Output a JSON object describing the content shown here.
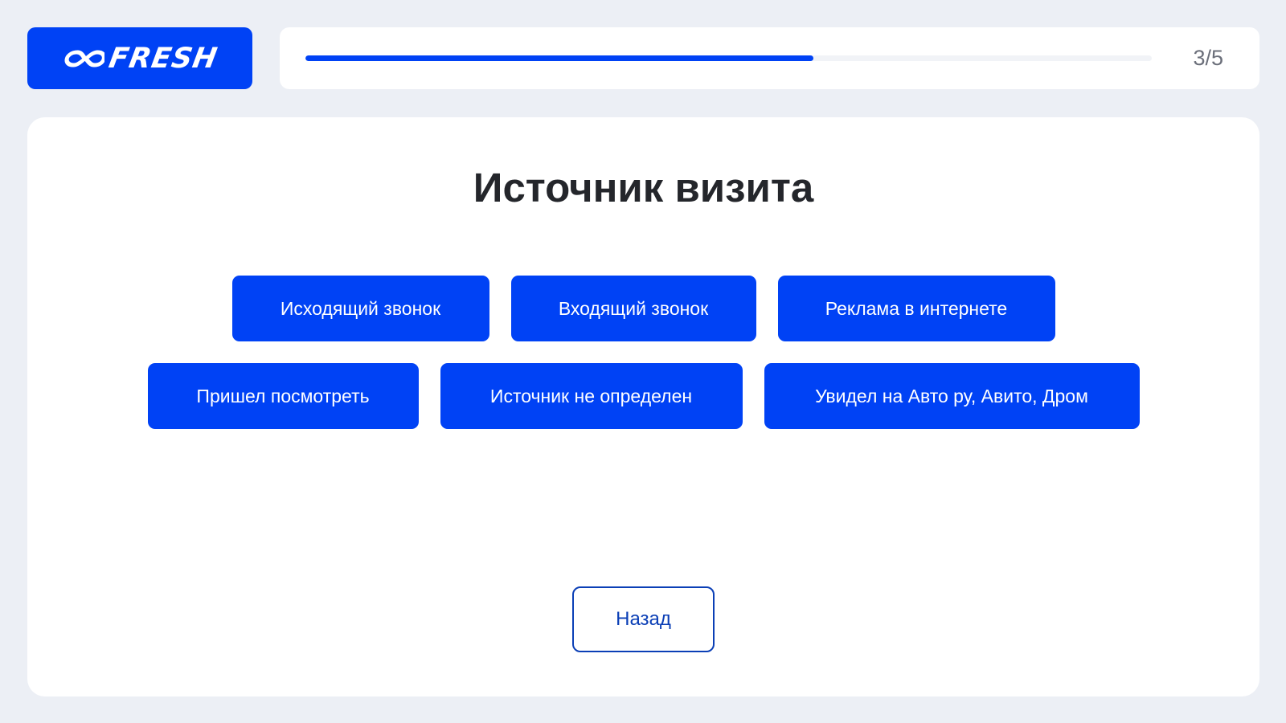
{
  "brand": {
    "name": "FRESH",
    "logo_icon": "infinity-icon",
    "color": "#0042f5"
  },
  "progress": {
    "current": 3,
    "total": 5,
    "counter_label": "3/5",
    "fill_fraction": 0.6
  },
  "screen": {
    "title": "Источник визита"
  },
  "options": [
    "Исходящий звонок",
    "Входящий звонок",
    "Реклама в интернете",
    "Пришел посмотреть",
    "Источник не определен",
    "Увидел на Авто ру, Авито, Дром"
  ],
  "nav": {
    "back_label": "Назад"
  },
  "colors": {
    "accent": "#0042f5",
    "back_border": "#0b3fb6",
    "page_background": "#eceff5",
    "card_background": "#ffffff",
    "title_text": "#24262b",
    "counter_text": "#6b6f7a"
  }
}
